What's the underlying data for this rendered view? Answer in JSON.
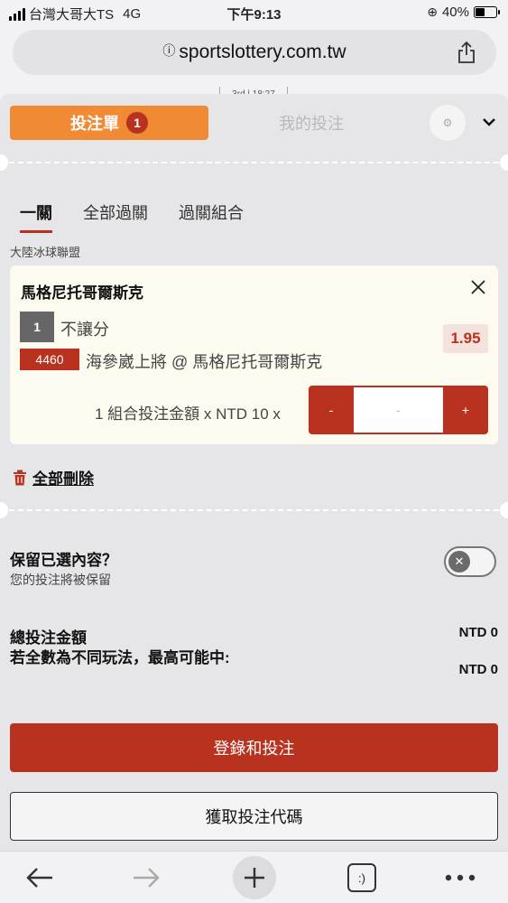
{
  "status_bar": {
    "carrier": "台灣大哥大TS",
    "network": "4G",
    "time": "下午9:13",
    "battery": "40%"
  },
  "browser": {
    "url": "sportslottery.com.tw"
  },
  "peek_tab": "3rd | 18:27",
  "betslip": {
    "tab_active": "投注單",
    "tab_count": "1",
    "tab_inactive": "我的投注",
    "subtabs": [
      "一關",
      "全部過關",
      "過關組合"
    ],
    "league": "大陸冰球聯盟",
    "bet": {
      "match": "馬格尼托哥爾斯克",
      "number": "1",
      "type": "不讓分",
      "code": "4460",
      "selection": "海參崴上將 @ 馬格尼托哥爾斯克",
      "odds": "1.95",
      "stake_label": "1 組合投注金額 x NTD 10 x",
      "stepper_minus": "-",
      "stepper_value": "-",
      "stepper_plus": "+"
    },
    "delete_all": "全部刪除",
    "keep_title": "保留已選內容？",
    "keep_sub": "您的投注將被保留",
    "total_label": "總投注金額",
    "total_value": "NTD 0",
    "max_label": "若全數為不同玩法，最高可能中:",
    "max_value": "NTD 0",
    "login_button": "登錄和投注",
    "code_button": "獲取投注代碼"
  },
  "colors": {
    "orange": "#f08a35",
    "red": "#b8321f",
    "card_bg": "#fdfbef"
  }
}
